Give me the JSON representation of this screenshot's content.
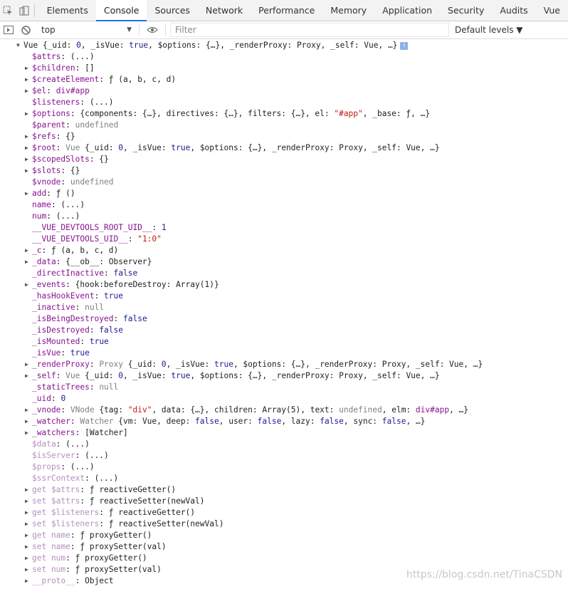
{
  "tabs": [
    "Elements",
    "Console",
    "Sources",
    "Network",
    "Performance",
    "Memory",
    "Application",
    "Security",
    "Audits",
    "Vue"
  ],
  "active_tab": 1,
  "toolbar": {
    "context": "top",
    "filter_placeholder": "Filter",
    "levels": "Default levels ▼"
  },
  "watermark": "https://blog.csdn.net/TinaCSDN",
  "lines": [
    {
      "indent": 0,
      "arrow": "down",
      "segs": [
        [
          "i v",
          "Vue "
        ],
        [
          "i v",
          "{_uid: "
        ],
        [
          "i num",
          "0"
        ],
        [
          "i v",
          ", _isVue: "
        ],
        [
          "i bool",
          "true"
        ],
        [
          "i v",
          ", $options: {…}, _renderProxy: Proxy, _self: Vue, …}"
        ]
      ],
      "info": "i"
    },
    {
      "indent": 1,
      "arrow": "",
      "segs": [
        [
          "k",
          "$attrs"
        ],
        [
          "v",
          ": (...)"
        ]
      ]
    },
    {
      "indent": 1,
      "arrow": "right",
      "segs": [
        [
          "k",
          "$children"
        ],
        [
          "v",
          ": []"
        ]
      ]
    },
    {
      "indent": 1,
      "arrow": "right",
      "segs": [
        [
          "k",
          "$createElement"
        ],
        [
          "v",
          ": "
        ],
        [
          "i v",
          "ƒ (a, b, c, d)"
        ]
      ]
    },
    {
      "indent": 1,
      "arrow": "right",
      "segs": [
        [
          "k",
          "$el"
        ],
        [
          "v",
          ": "
        ],
        [
          "el",
          "div#app"
        ]
      ]
    },
    {
      "indent": 1,
      "arrow": "",
      "segs": [
        [
          "k",
          "$listeners"
        ],
        [
          "v",
          ": (...)"
        ]
      ]
    },
    {
      "indent": 1,
      "arrow": "right",
      "segs": [
        [
          "k",
          "$options"
        ],
        [
          "v",
          ": {components: {…}, directives: {…}, filters: {…}, el: "
        ],
        [
          "str",
          "\"#app\""
        ],
        [
          "v",
          ", _base: ƒ, …}"
        ]
      ]
    },
    {
      "indent": 1,
      "arrow": "",
      "segs": [
        [
          "k",
          "$parent"
        ],
        [
          "v",
          ": "
        ],
        [
          "nul",
          "undefined"
        ]
      ]
    },
    {
      "indent": 1,
      "arrow": "right",
      "segs": [
        [
          "k",
          "$refs"
        ],
        [
          "v",
          ": {}"
        ]
      ]
    },
    {
      "indent": 1,
      "arrow": "right",
      "segs": [
        [
          "k",
          "$root"
        ],
        [
          "v",
          ": "
        ],
        [
          "nul",
          "Vue "
        ],
        [
          "v",
          "{_uid: "
        ],
        [
          "num",
          "0"
        ],
        [
          "v",
          ", _isVue: "
        ],
        [
          "bool",
          "true"
        ],
        [
          "v",
          ", $options: {…}, _renderProxy: Proxy, _self: Vue, …}"
        ]
      ]
    },
    {
      "indent": 1,
      "arrow": "right",
      "segs": [
        [
          "k",
          "$scopedSlots"
        ],
        [
          "v",
          ": {}"
        ]
      ]
    },
    {
      "indent": 1,
      "arrow": "right",
      "segs": [
        [
          "k",
          "$slots"
        ],
        [
          "v",
          ": {}"
        ]
      ]
    },
    {
      "indent": 1,
      "arrow": "",
      "segs": [
        [
          "k",
          "$vnode"
        ],
        [
          "v",
          ": "
        ],
        [
          "nul",
          "undefined"
        ]
      ]
    },
    {
      "indent": 1,
      "arrow": "right",
      "segs": [
        [
          "k",
          "add"
        ],
        [
          "v",
          ": "
        ],
        [
          "i v",
          "ƒ ()"
        ]
      ]
    },
    {
      "indent": 1,
      "arrow": "",
      "segs": [
        [
          "k",
          "name"
        ],
        [
          "v",
          ": (...)"
        ]
      ]
    },
    {
      "indent": 1,
      "arrow": "",
      "segs": [
        [
          "k",
          "num"
        ],
        [
          "v",
          ": (...)"
        ]
      ]
    },
    {
      "indent": 1,
      "arrow": "",
      "segs": [
        [
          "k",
          "__VUE_DEVTOOLS_ROOT_UID__"
        ],
        [
          "v",
          ": "
        ],
        [
          "num",
          "1"
        ]
      ]
    },
    {
      "indent": 1,
      "arrow": "",
      "segs": [
        [
          "k",
          "__VUE_DEVTOOLS_UID__"
        ],
        [
          "v",
          ": "
        ],
        [
          "str",
          "\"1:0\""
        ]
      ]
    },
    {
      "indent": 1,
      "arrow": "right",
      "segs": [
        [
          "k",
          "_c"
        ],
        [
          "v",
          ": "
        ],
        [
          "i v",
          "ƒ (a, b, c, d)"
        ]
      ]
    },
    {
      "indent": 1,
      "arrow": "right",
      "segs": [
        [
          "k",
          "_data"
        ],
        [
          "v",
          ": {__ob__: Observer}"
        ]
      ]
    },
    {
      "indent": 1,
      "arrow": "",
      "segs": [
        [
          "k",
          "_directInactive"
        ],
        [
          "v",
          ": "
        ],
        [
          "bool",
          "false"
        ]
      ]
    },
    {
      "indent": 1,
      "arrow": "right",
      "segs": [
        [
          "k",
          "_events"
        ],
        [
          "v",
          ": {hook:beforeDestroy: Array(1)}"
        ]
      ]
    },
    {
      "indent": 1,
      "arrow": "",
      "segs": [
        [
          "k",
          "_hasHookEvent"
        ],
        [
          "v",
          ": "
        ],
        [
          "bool",
          "true"
        ]
      ]
    },
    {
      "indent": 1,
      "arrow": "",
      "segs": [
        [
          "k",
          "_inactive"
        ],
        [
          "v",
          ": "
        ],
        [
          "nul",
          "null"
        ]
      ]
    },
    {
      "indent": 1,
      "arrow": "",
      "segs": [
        [
          "k",
          "_isBeingDestroyed"
        ],
        [
          "v",
          ": "
        ],
        [
          "bool",
          "false"
        ]
      ]
    },
    {
      "indent": 1,
      "arrow": "",
      "segs": [
        [
          "k",
          "_isDestroyed"
        ],
        [
          "v",
          ": "
        ],
        [
          "bool",
          "false"
        ]
      ]
    },
    {
      "indent": 1,
      "arrow": "",
      "segs": [
        [
          "k",
          "_isMounted"
        ],
        [
          "v",
          ": "
        ],
        [
          "bool",
          "true"
        ]
      ]
    },
    {
      "indent": 1,
      "arrow": "",
      "segs": [
        [
          "k",
          "_isVue"
        ],
        [
          "v",
          ": "
        ],
        [
          "bool",
          "true"
        ]
      ]
    },
    {
      "indent": 1,
      "arrow": "right",
      "segs": [
        [
          "k",
          "_renderProxy"
        ],
        [
          "v",
          ": "
        ],
        [
          "nul",
          "Proxy "
        ],
        [
          "v",
          "{_uid: "
        ],
        [
          "num",
          "0"
        ],
        [
          "v",
          ", _isVue: "
        ],
        [
          "bool",
          "true"
        ],
        [
          "v",
          ", $options: {…}, _renderProxy: Proxy, _self: Vue, …}"
        ]
      ]
    },
    {
      "indent": 1,
      "arrow": "right",
      "segs": [
        [
          "k",
          "_self"
        ],
        [
          "v",
          ": "
        ],
        [
          "nul",
          "Vue "
        ],
        [
          "v",
          "{_uid: "
        ],
        [
          "num",
          "0"
        ],
        [
          "v",
          ", _isVue: "
        ],
        [
          "bool",
          "true"
        ],
        [
          "v",
          ", $options: {…}, _renderProxy: Proxy, _self: Vue, …}"
        ]
      ]
    },
    {
      "indent": 1,
      "arrow": "",
      "segs": [
        [
          "k",
          "_staticTrees"
        ],
        [
          "v",
          ": "
        ],
        [
          "nul",
          "null"
        ]
      ]
    },
    {
      "indent": 1,
      "arrow": "",
      "segs": [
        [
          "k",
          "_uid"
        ],
        [
          "v",
          ": "
        ],
        [
          "num",
          "0"
        ]
      ]
    },
    {
      "indent": 1,
      "arrow": "right",
      "segs": [
        [
          "k",
          "_vnode"
        ],
        [
          "v",
          ": "
        ],
        [
          "nul",
          "VNode "
        ],
        [
          "v",
          "{tag: "
        ],
        [
          "str",
          "\"div\""
        ],
        [
          "v",
          ", data: {…}, children: Array(5), text: "
        ],
        [
          "nul",
          "undefined"
        ],
        [
          "v",
          ", elm: "
        ],
        [
          "el",
          "div#app"
        ],
        [
          "v",
          ", …}"
        ]
      ]
    },
    {
      "indent": 1,
      "arrow": "right",
      "segs": [
        [
          "k",
          "_watcher"
        ],
        [
          "v",
          ": "
        ],
        [
          "nul",
          "Watcher "
        ],
        [
          "v",
          "{vm: Vue, deep: "
        ],
        [
          "bool",
          "false"
        ],
        [
          "v",
          ", user: "
        ],
        [
          "bool",
          "false"
        ],
        [
          "v",
          ", lazy: "
        ],
        [
          "bool",
          "false"
        ],
        [
          "v",
          ", sync: "
        ],
        [
          "bool",
          "false"
        ],
        [
          "v",
          ", …}"
        ]
      ]
    },
    {
      "indent": 1,
      "arrow": "right",
      "segs": [
        [
          "k",
          "_watchers"
        ],
        [
          "v",
          ": [Watcher]"
        ]
      ]
    },
    {
      "indent": 1,
      "arrow": "",
      "segs": [
        [
          "kd",
          "$data"
        ],
        [
          "v",
          ": (...)"
        ]
      ]
    },
    {
      "indent": 1,
      "arrow": "",
      "segs": [
        [
          "kd",
          "$isServer"
        ],
        [
          "v",
          ": (...)"
        ]
      ]
    },
    {
      "indent": 1,
      "arrow": "",
      "segs": [
        [
          "kd",
          "$props"
        ],
        [
          "v",
          ": (...)"
        ]
      ]
    },
    {
      "indent": 1,
      "arrow": "",
      "segs": [
        [
          "kd",
          "$ssrContext"
        ],
        [
          "v",
          ": (...)"
        ]
      ]
    },
    {
      "indent": 1,
      "arrow": "right",
      "segs": [
        [
          "kd",
          "get $attrs"
        ],
        [
          "v",
          ": "
        ],
        [
          "i v",
          "ƒ reactiveGetter()"
        ]
      ]
    },
    {
      "indent": 1,
      "arrow": "right",
      "segs": [
        [
          "kd",
          "set $attrs"
        ],
        [
          "v",
          ": "
        ],
        [
          "i v",
          "ƒ reactiveSetter(newVal)"
        ]
      ]
    },
    {
      "indent": 1,
      "arrow": "right",
      "segs": [
        [
          "kd",
          "get $listeners"
        ],
        [
          "v",
          ": "
        ],
        [
          "i v",
          "ƒ reactiveGetter()"
        ]
      ]
    },
    {
      "indent": 1,
      "arrow": "right",
      "segs": [
        [
          "kd",
          "set $listeners"
        ],
        [
          "v",
          ": "
        ],
        [
          "i v",
          "ƒ reactiveSetter(newVal)"
        ]
      ]
    },
    {
      "indent": 1,
      "arrow": "right",
      "segs": [
        [
          "kd",
          "get name"
        ],
        [
          "v",
          ": "
        ],
        [
          "i v",
          "ƒ proxyGetter()"
        ]
      ]
    },
    {
      "indent": 1,
      "arrow": "right",
      "segs": [
        [
          "kd",
          "set name"
        ],
        [
          "v",
          ": "
        ],
        [
          "i v",
          "ƒ proxySetter(val)"
        ]
      ]
    },
    {
      "indent": 1,
      "arrow": "right",
      "segs": [
        [
          "kd",
          "get num"
        ],
        [
          "v",
          ": "
        ],
        [
          "i v",
          "ƒ proxyGetter()"
        ]
      ]
    },
    {
      "indent": 1,
      "arrow": "right",
      "segs": [
        [
          "kd",
          "set num"
        ],
        [
          "v",
          ": "
        ],
        [
          "i v",
          "ƒ proxySetter(val)"
        ]
      ]
    },
    {
      "indent": 1,
      "arrow": "right",
      "segs": [
        [
          "kd",
          "__proto__"
        ],
        [
          "v",
          ": Object"
        ]
      ]
    }
  ]
}
